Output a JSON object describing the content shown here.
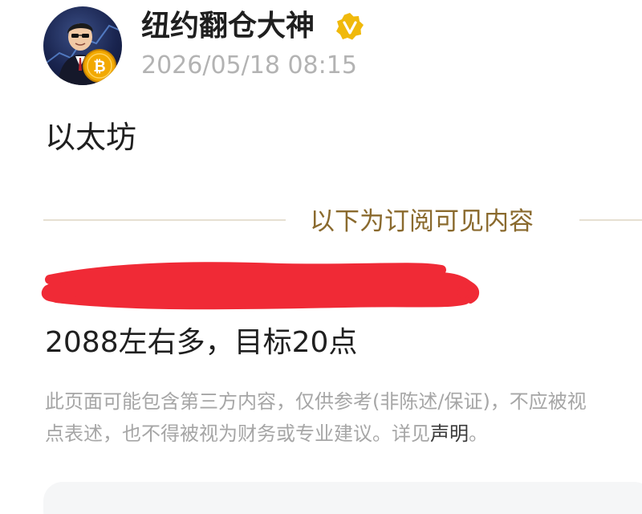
{
  "author": {
    "name": "纽约翻仓大神",
    "timestamp": "2026/05/18 08:15",
    "verified_icon": "verified-v-badge",
    "avatar_icon": "avatar-man-with-bitcoin"
  },
  "post": {
    "title": "以太坊",
    "divider_label": "以下为订阅可见内容",
    "body": "2088左右多，目标20点"
  },
  "disclaimer": {
    "line1": "此页面可能包含第三方内容，仅供参考(非陈述/保证)，不应被视",
    "line2_prefix": "点表述，也不得被视为财务或专业建议。详见",
    "link_label": "声明",
    "line2_suffix": "。"
  },
  "colors": {
    "accent_gold": "#8a6a2e",
    "badge_gold": "#f0b90b",
    "redaction_red": "#f02a36",
    "muted_text": "#a6a6a6"
  }
}
